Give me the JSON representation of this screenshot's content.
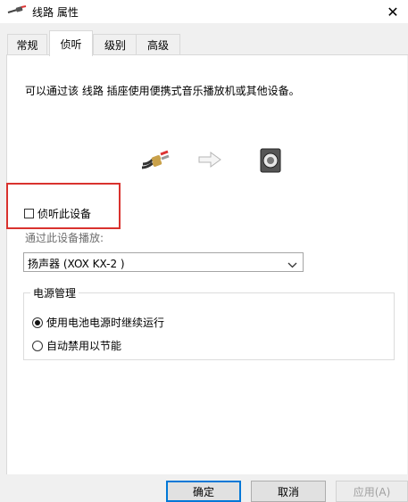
{
  "window": {
    "title": "线路 属性",
    "icon": "line-in-jack-icon",
    "close_glyph": "✕"
  },
  "tabs": [
    {
      "label": "常规"
    },
    {
      "label": "侦听",
      "active": true
    },
    {
      "label": "级别"
    },
    {
      "label": "高级"
    }
  ],
  "content": {
    "description": "可以通过该 线路 插座使用便携式音乐播放机或其他设备。",
    "listen_checkbox": {
      "label": "侦听此设备",
      "checked": false
    },
    "playback_label": "通过此设备播放:",
    "playback_select": {
      "value": "扬声器 (XOX KX-2 )"
    },
    "power_group": {
      "title": "电源管理",
      "options": [
        {
          "label": "使用电池电源时继续运行",
          "selected": true
        },
        {
          "label": "自动禁用以节能",
          "selected": false
        }
      ]
    }
  },
  "buttons": {
    "ok": "确定",
    "cancel": "取消",
    "apply": "应用(A)"
  },
  "colors": {
    "highlight": "#d9322e",
    "accent": "#0078d7"
  }
}
